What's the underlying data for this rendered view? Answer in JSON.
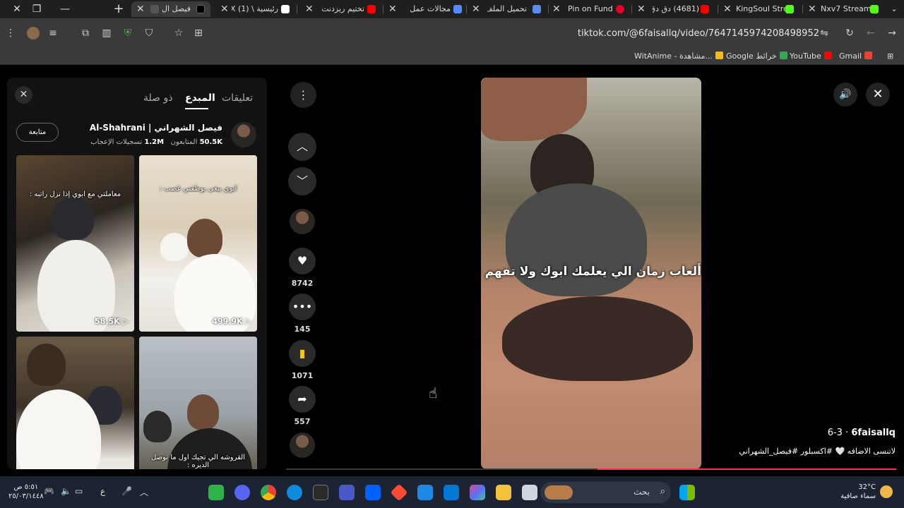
{
  "browser": {
    "tabs": [
      {
        "title": "فيصل ال",
        "active": true,
        "favicon": "tiktok",
        "color": "#ffffff"
      },
      {
        "title": "رئيسية \\ X (1)",
        "favicon": "x",
        "color": "#ffffff"
      },
      {
        "title": "تختيم ريزدنت",
        "favicon": "youtube",
        "color": "#ff0000"
      },
      {
        "title": "مجالات عمل",
        "favicon": "gemini",
        "color": "#4e8cff"
      },
      {
        "title": "تحميل الملف",
        "favicon": "diamond",
        "color": "#5a8dee"
      },
      {
        "title": "Pin on Fundo",
        "favicon": "pinterest",
        "color": "#e60023"
      },
      {
        "title": "(4681) دق دق",
        "favicon": "youtube",
        "color": "#ff0000"
      },
      {
        "title": "KingSoul Stre",
        "favicon": "kick",
        "color": "#53fc18"
      },
      {
        "title": "Nxv7 Stream",
        "favicon": "kick",
        "color": "#53fc18"
      }
    ],
    "url": "tiktok.com/@6faisallq/video/7647145974208498952",
    "bookmarks": [
      {
        "label": "Gmail",
        "color": "#ea4335"
      },
      {
        "label": "YouTube",
        "color": "#ff0000"
      },
      {
        "label": "Google خرائط",
        "color": "#34a853"
      },
      {
        "label": "WitAnime - مشاهدة...",
        "color": "#fbbc05"
      }
    ]
  },
  "panel": {
    "tabs": {
      "comments": "تعليقات",
      "creator": "المبدع",
      "related": "ذو صلة"
    },
    "follow_label": "متابعة",
    "creator_name": "فيصل الشهراني | Al-Shahrani",
    "followers_count": "50.5K",
    "followers_label": "المتابعون",
    "likes_count": "1.2M",
    "likes_label": "تسجيلات الإعجاب",
    "videos": [
      {
        "caption": "معاملتي مع ابوي إذا نزل راتبه :",
        "views": "58.5K"
      },
      {
        "caption": "ابوي يبغى يوظفني غصب :",
        "views": "499.9K"
      },
      {
        "caption": "",
        "views": ""
      },
      {
        "caption": "القروشه الي تجيك اول ما توصل الديره :",
        "views": ""
      }
    ]
  },
  "actions": {
    "likes": "8742",
    "comments": "145",
    "saves": "1071",
    "shares": "557"
  },
  "video": {
    "subtitle": "ألعاب زمان الي يعلمك ابوك ولا تفهم :",
    "author": "6faisallq",
    "date": "6-3",
    "description": "لاتنسى الاضافه 🤍 #اكسبلور #فيصل_الشهراني",
    "progress": 0.49
  },
  "taskbar": {
    "search_placeholder": "بحث",
    "temperature": "32°C",
    "weather": "سماء صافية",
    "time": "٥:٥١ ص",
    "date": "٢٥/٠٣/١٤٤٨",
    "lang": "ع"
  }
}
